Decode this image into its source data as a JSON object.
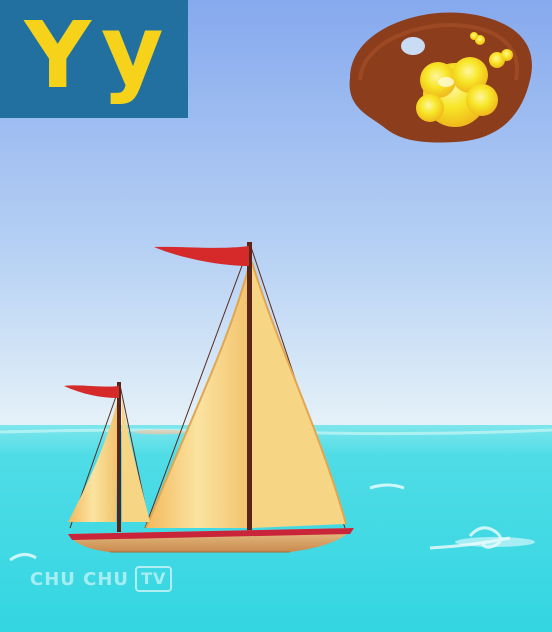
{
  "card": {
    "upper": "Y",
    "lower": "y",
    "background": "#2170a0",
    "letter_color": "#f6d21a"
  },
  "watermark": {
    "text": "CHU CHU",
    "badge": "TV"
  },
  "scene": {
    "sky_top": "#8aaef0",
    "sky_bottom": "#dcecf8",
    "sea": "#3cd9e4",
    "sail_color": "#f7d27a",
    "flag_color": "#d82828",
    "hull_color": "#c8243a",
    "palette_color": "#8a3b1e",
    "paint_color": "#f5e020"
  }
}
